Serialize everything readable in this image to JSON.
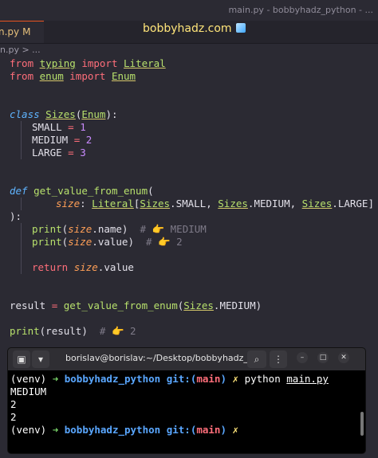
{
  "window": {
    "title": "main.py - bobbyhadz_python - ..."
  },
  "tab": {
    "label": "n.py",
    "modified": "M"
  },
  "site": {
    "title": "bobbyhadz.com"
  },
  "breadcrumb": {
    "text": "n.py > ..."
  },
  "editor": {
    "lines": [
      {
        "id": "l1"
      },
      {
        "id": "l2"
      }
    ],
    "code": {
      "from1": "from",
      "typing": "typing",
      "import1": "import",
      "Literal": "Literal",
      "from2": "from",
      "enum": "enum",
      "import2": "import",
      "Enum": "Enum",
      "class": "class",
      "Sizes": "Sizes",
      "EnumBase": "Enum",
      "SMALL": "SMALL",
      "SMALL_v": "1",
      "MEDIUM": "MEDIUM",
      "MEDIUM_v": "2",
      "LARGE": "LARGE",
      "LARGE_v": "3",
      "def": "def",
      "fname": "get_value_from_enum",
      "param": "size",
      "ann_lit": "Literal",
      "s1": "Sizes",
      "a1": "SMALL",
      "s2": "Sizes",
      "a2": "MEDIUM",
      "s3": "Sizes",
      "a3": "LARGE",
      "close": "):",
      "print1": "print",
      "p1param": "size",
      "p1attr": "name",
      "c1": "# 👉 MEDIUM",
      "print2": "print",
      "p2param": "size",
      "p2attr": "value",
      "c2": "# 👉 2",
      "return": "return",
      "rparam": "size",
      "rattr": "value",
      "result": "result",
      "call": "get_value_from_enum",
      "cs": "Sizes",
      "ca": "MEDIUM",
      "print3": "print",
      "p3arg": "result",
      "c3": "# 👉 2"
    }
  },
  "terminal": {
    "title": "borislav@borislav:~/Desktop/bobbyhadz_...",
    "prompt_venv": "(venv)",
    "arrow": "➜",
    "dir": "bobbyhadz_python",
    "git": "git:",
    "branch_open": "(",
    "branch": "main",
    "branch_close": ")",
    "x": "✗",
    "cmd": "python",
    "file": "main.py",
    "out1": "MEDIUM",
    "out2": "2",
    "out3": "2"
  },
  "colors": {
    "editor_bg": "#2b2a33",
    "terminal_bg": "#000000",
    "accent": "#e95420"
  }
}
